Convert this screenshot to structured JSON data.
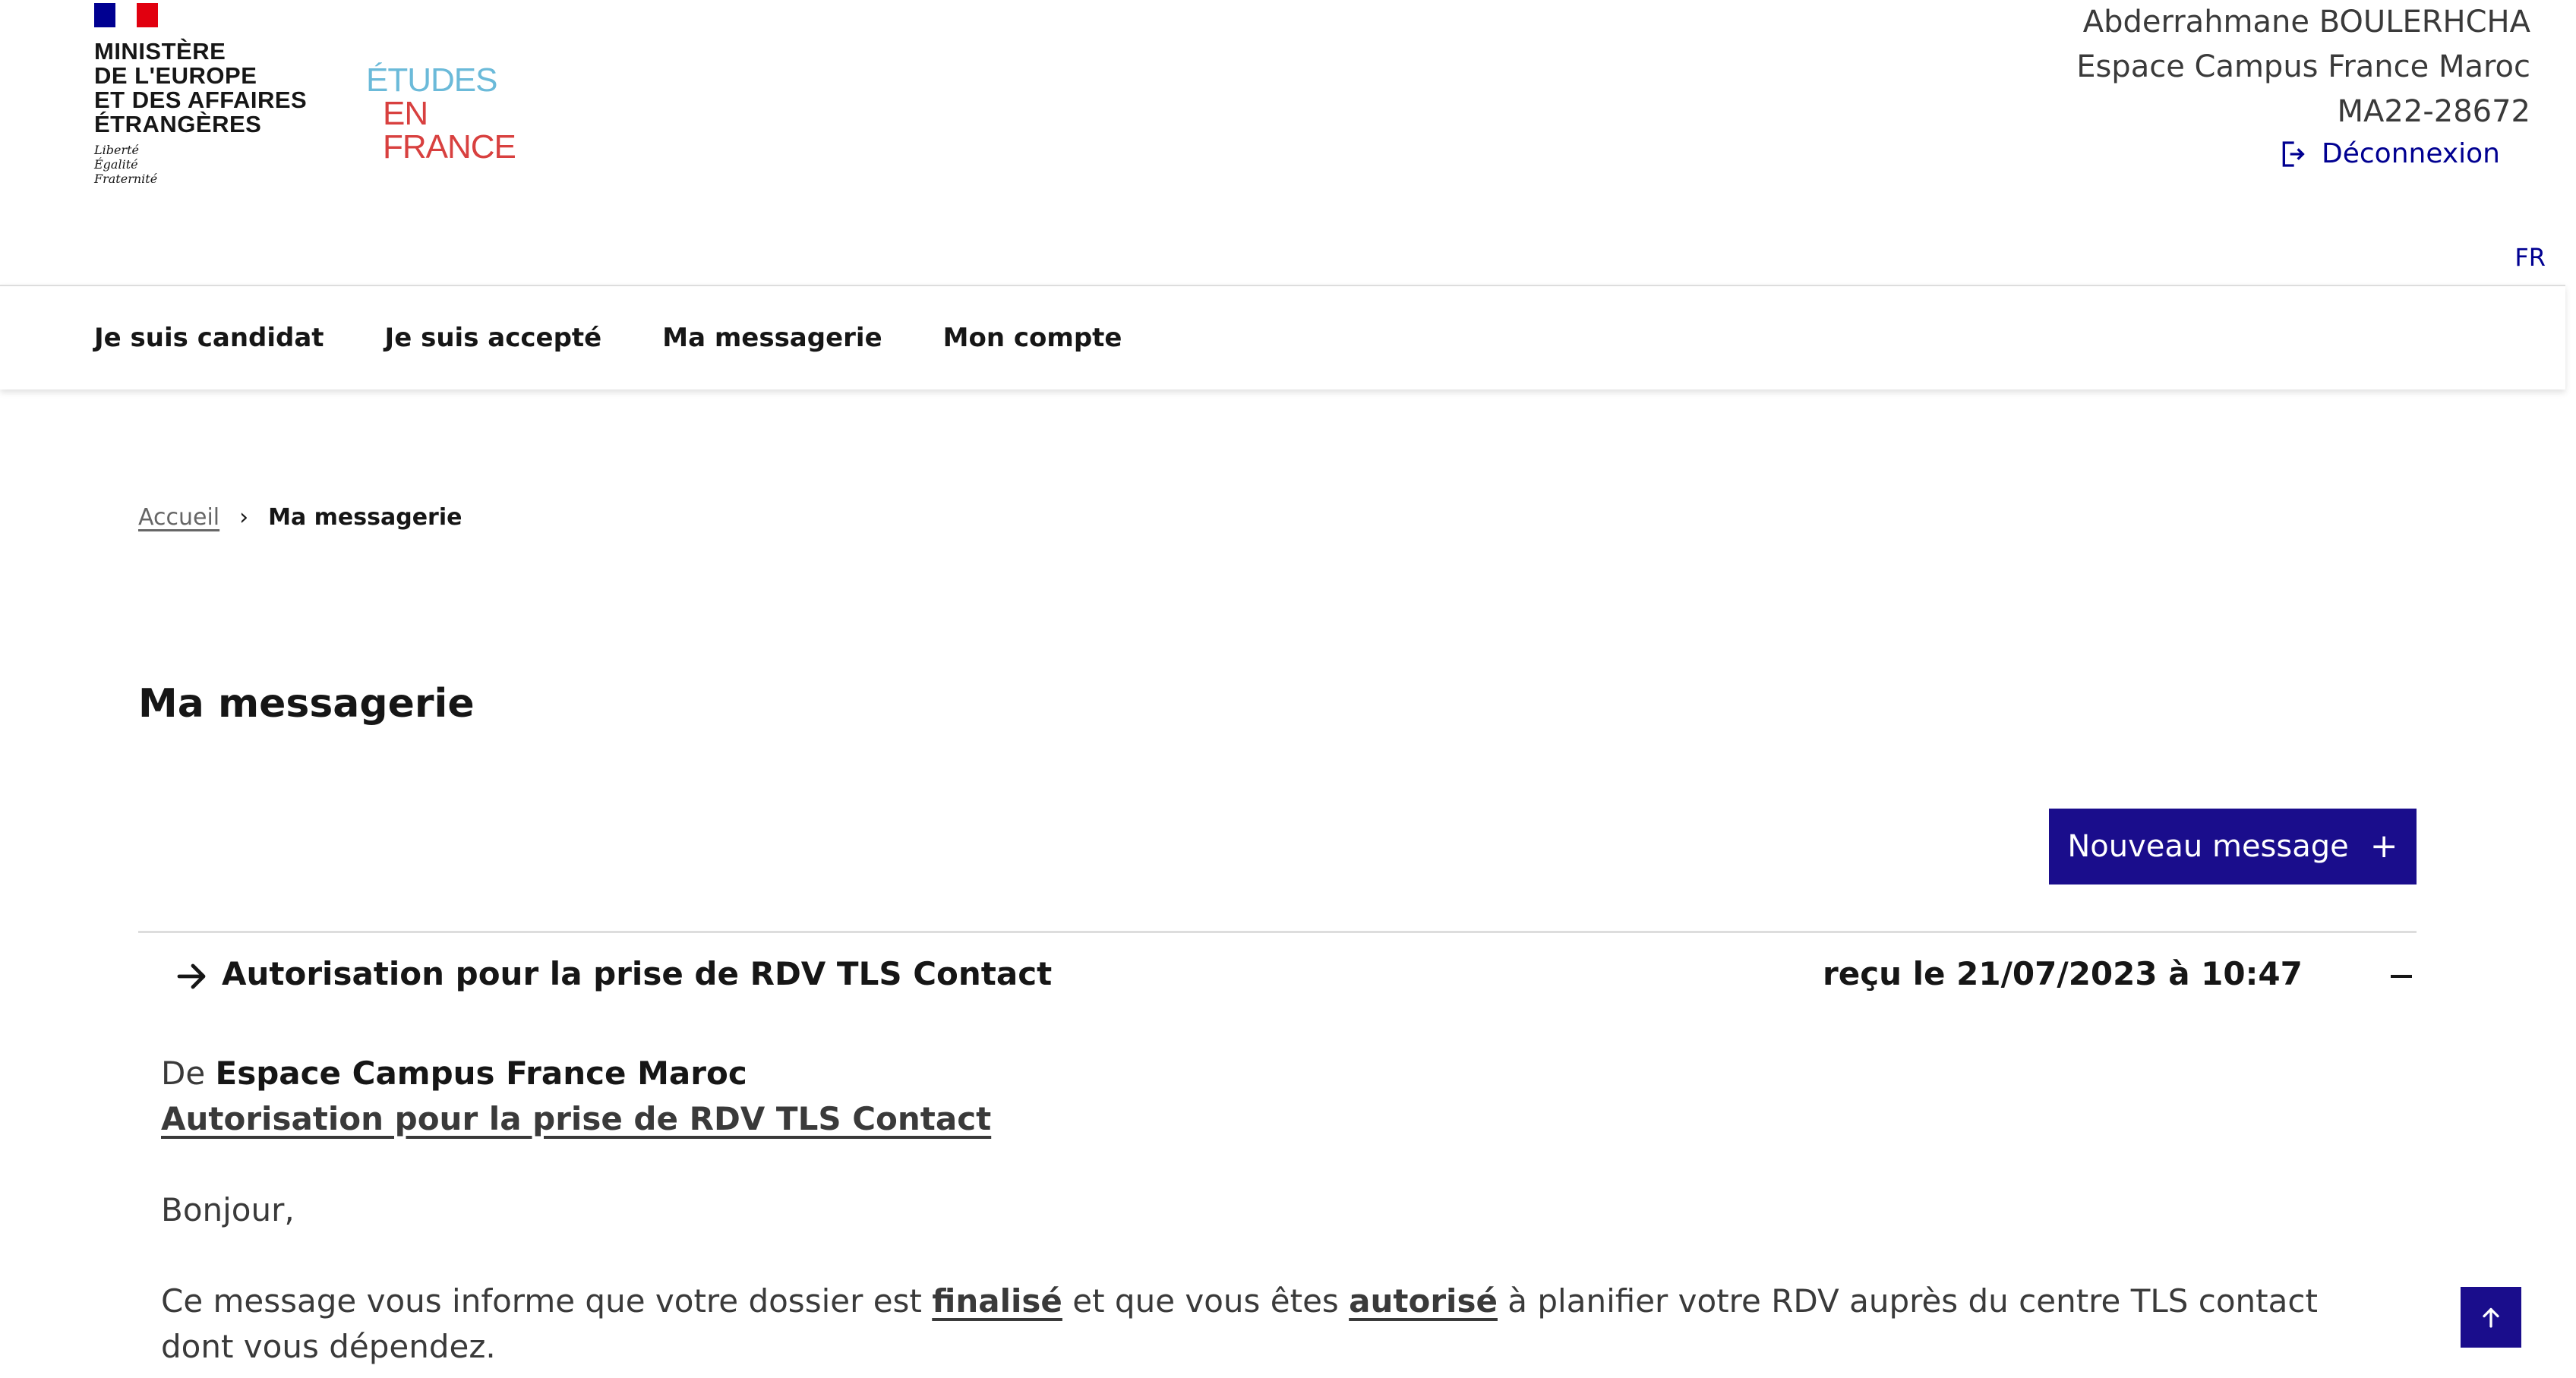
{
  "header": {
    "ministry_lines": [
      "MINISTÈRE",
      "DE L'EUROPE",
      "ET DES AFFAIRES",
      "ÉTRANGÈRES"
    ],
    "motto_lines": [
      "Liberté",
      "Égalité",
      "Fraternité"
    ],
    "etudes_logo": {
      "line1": "ÉTUDES",
      "line2": "EN FRANCE"
    },
    "user": {
      "name": "Abderrahmane BOULERHCHA",
      "espace": "Espace Campus France Maroc",
      "id": "MA22-28672"
    },
    "logout_label": "Déconnexion",
    "language": "FR"
  },
  "nav": {
    "items": [
      {
        "label": "Je suis candidat"
      },
      {
        "label": "Je suis accepté"
      },
      {
        "label": "Ma messagerie"
      },
      {
        "label": "Mon compte"
      }
    ]
  },
  "breadcrumb": {
    "home": "Accueil",
    "current": "Ma messagerie"
  },
  "page_title": "Ma messagerie",
  "new_message_button": {
    "label": "Nouveau message",
    "icon": "plus-icon"
  },
  "message": {
    "subject": "Autorisation pour la prise de RDV TLS Contact",
    "received": "reçu le 21/07/2023 à 10:47",
    "from_prefix": "De",
    "from": "Espace Campus France Maroc",
    "subject_link": "Autorisation pour la prise de RDV TLS Contact",
    "greeting": "Bonjour,",
    "body": {
      "part1": "Ce message vous informe que votre dossier est ",
      "finalise": "finalisé",
      "part2": " et que vous êtes ",
      "autorise": "autorisé",
      "part3": " à planifier votre RDV auprès du centre TLS contact dont vous dépendez."
    }
  },
  "colors": {
    "primary": "#000091",
    "button": "#1a0d8c",
    "etudes_blue": "#6bbad9",
    "etudes_red": "#d8403f"
  }
}
